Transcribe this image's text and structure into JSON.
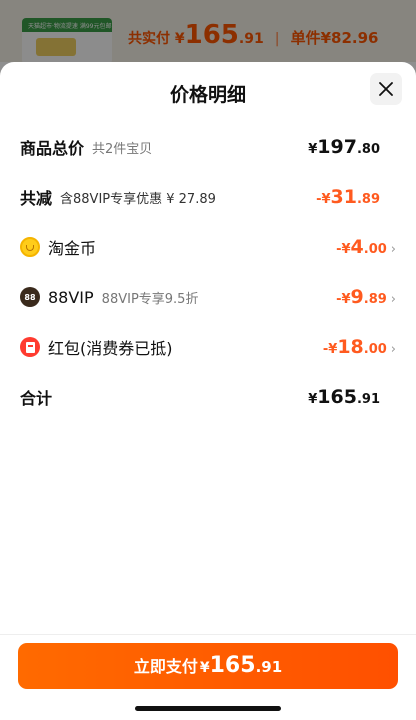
{
  "background": {
    "thumb_strip_text": "天猫超市·物流提速 满99元包邮",
    "total_label": "共实付",
    "total_currency": "¥",
    "total_int": "165",
    "total_dec": ".91",
    "separator": "|",
    "unit_label": "单件",
    "unit_price": "¥82.96"
  },
  "sheet": {
    "title": "价格明细",
    "close_icon": "close-icon",
    "rows": {
      "goods_total": {
        "label": "商品总价",
        "sub": "共2件宝贝",
        "cur": "¥",
        "int": "197",
        "dec": ".80"
      },
      "discount": {
        "label": "共减",
        "sub": "含88VIP专享优惠 ¥ 27.89",
        "cur": "-¥",
        "int": "31",
        "dec": ".89"
      },
      "taojin": {
        "label": "淘金币",
        "icon": "coin-icon",
        "cur": "-¥",
        "int": "4",
        "dec": ".00",
        "chevron": "›"
      },
      "vip": {
        "label": "88VIP",
        "icon_text": "88",
        "sub": "88VIP专享9.5折",
        "cur": "-¥",
        "int": "9",
        "dec": ".89",
        "chevron": "›"
      },
      "redpacket": {
        "label": "红包(消费券已抵)",
        "icon": "red-packet-icon",
        "cur": "-¥",
        "int": "18",
        "dec": ".00",
        "chevron": "›"
      },
      "sum": {
        "label": "合计",
        "cur": "¥",
        "int": "165",
        "dec": ".91"
      }
    }
  },
  "footer": {
    "pay_label": "立即支付",
    "pay_cur": "¥",
    "pay_int": "165",
    "pay_dec": ".91"
  },
  "colors": {
    "accent": "#ff5a1f",
    "button": "#ff5a00"
  }
}
